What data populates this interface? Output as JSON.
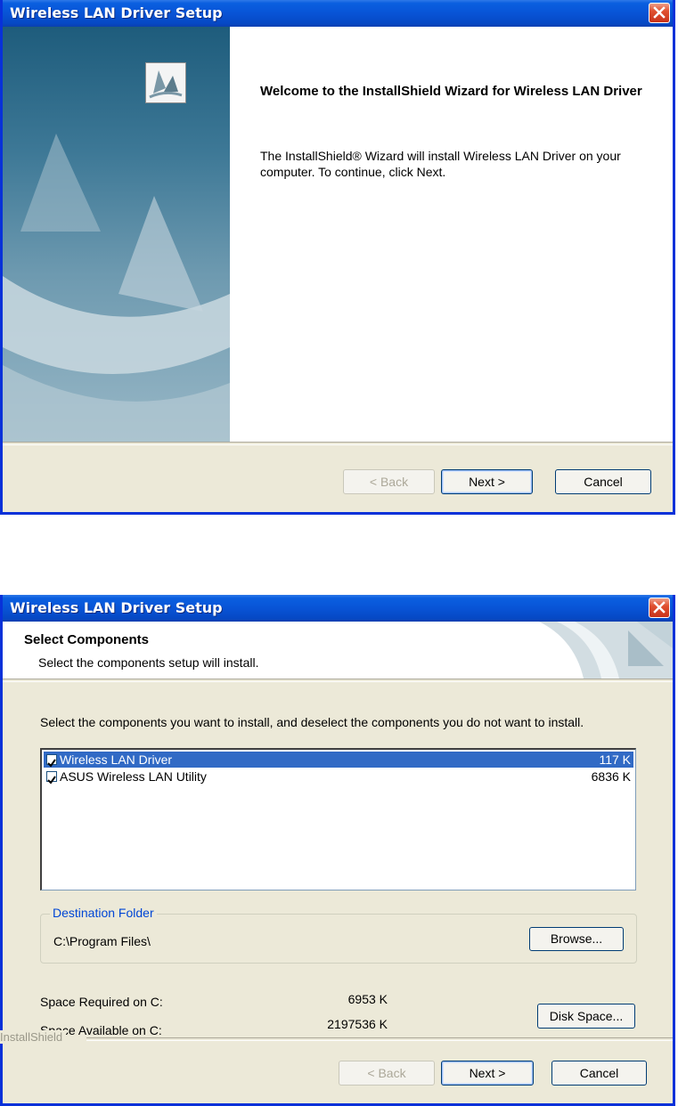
{
  "window1": {
    "title": "Wireless LAN Driver Setup",
    "heading": "Welcome to the InstallShield Wizard for Wireless LAN Driver",
    "body": "The InstallShield® Wizard will install Wireless LAN Driver on your computer.  To continue, click Next.",
    "buttons": {
      "back": "< Back",
      "next": "Next >",
      "cancel": "Cancel"
    }
  },
  "window2": {
    "title": "Wireless LAN Driver Setup",
    "header_title": "Select Components",
    "header_subtitle": "Select the components setup will install.",
    "instruction": "Select the components you want to install, and deselect the components you do not want to install.",
    "components": [
      {
        "label": "Wireless LAN Driver",
        "size": "117 K",
        "checked": true,
        "selected": true
      },
      {
        "label": "ASUS Wireless LAN Utility",
        "size": "6836 K",
        "checked": true,
        "selected": false
      }
    ],
    "destination": {
      "legend": "Destination Folder",
      "path": "C:\\Program Files\\",
      "browse": "Browse..."
    },
    "space_required_label": "Space Required on C:",
    "space_required_value": "6953 K",
    "space_available_label": "Space Available on C:",
    "space_available_value": "2197536 K",
    "disk_space_button": "Disk Space...",
    "brand_label": "InstallShield",
    "buttons": {
      "back": "< Back",
      "next": "Next >",
      "cancel": "Cancel"
    }
  }
}
